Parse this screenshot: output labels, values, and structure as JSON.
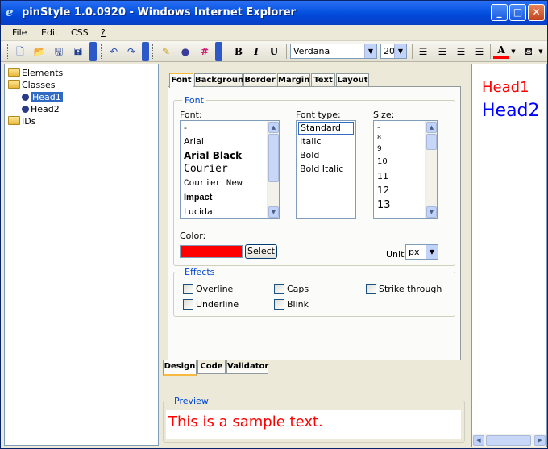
{
  "window": {
    "title": "pinStyle 1.0.0920 - Windows Internet Explorer",
    "icon": "ie-icon"
  },
  "menu": [
    "File",
    "Edit",
    "CSS",
    "?"
  ],
  "toolbar": {
    "font_value": "Verdana",
    "size_value": "20",
    "bold_label": "B",
    "italic_label": "I",
    "underline_label": "U",
    "font_color": "#ff0000"
  },
  "tree": {
    "elements": "Elements",
    "classes": "Classes",
    "head1": "Head1",
    "head2": "Head2",
    "ids": "IDs"
  },
  "tabs": [
    "Font",
    "Background",
    "Border",
    "Margin",
    "Text",
    "Layout"
  ],
  "font_group": {
    "legend": "Font",
    "font_label": "Font:",
    "font_type_label": "Font type:",
    "size_label": "Size:",
    "fonts": [
      "-",
      "Arial",
      "Arial Black",
      "Courier",
      "Courier New",
      "Impact",
      "Lucida"
    ],
    "font_types": [
      "Standard",
      "Italic",
      "Bold",
      "Bold Italic"
    ],
    "sizes": [
      "-",
      "8",
      "9",
      "10",
      "11",
      "12",
      "13"
    ],
    "color_label": "Color:",
    "color_value": "#ff0000",
    "select_button": "Select",
    "unit_label": "Unit:",
    "unit_value": "px"
  },
  "effects": {
    "legend": "Effects",
    "overline": "Overline",
    "caps": "Caps",
    "strike": "Strike through",
    "underline": "Underline",
    "blink": "Blink"
  },
  "bottom_tabs": [
    "Design",
    "Code",
    "Validator"
  ],
  "preview": {
    "legend": "Preview",
    "text": "This is a sample text."
  },
  "right_preview": {
    "head1": "Head1",
    "head2": "Head2"
  }
}
